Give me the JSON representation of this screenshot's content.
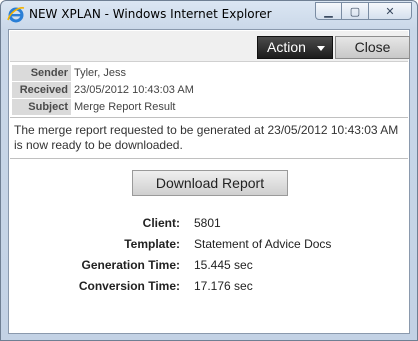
{
  "window": {
    "title": "NEW XPLAN - Windows Internet Explorer",
    "app_icon": "ie-logo-icon",
    "controls": {
      "minimize": "minimize-icon",
      "maximize": "maximize-icon",
      "close": "close-icon"
    }
  },
  "toolbar": {
    "action_label": "Action",
    "close_label": "Close"
  },
  "meta": {
    "sender_label": "Sender",
    "sender_value": "Tyler, Jess",
    "received_label": "Received",
    "received_value": "23/05/2012 10:43:03 AM",
    "subject_label": "Subject",
    "subject_value": "Merge Report Result"
  },
  "message": {
    "body": "The merge report requested to be generated at 23/05/2012 10:43:03 AM is now ready to be downloaded."
  },
  "download": {
    "label": "Download Report"
  },
  "details": [
    {
      "label": "Client:",
      "value": "5801"
    },
    {
      "label": "Template:",
      "value": "Statement of Advice Docs"
    },
    {
      "label": "Generation Time:",
      "value": "15.445 sec"
    },
    {
      "label": "Conversion Time:",
      "value": "17.176 sec"
    }
  ],
  "colors": {
    "action_button": "#2b2b2b",
    "label_bg": "#dadada",
    "title_bar": "#c9d7e8"
  }
}
